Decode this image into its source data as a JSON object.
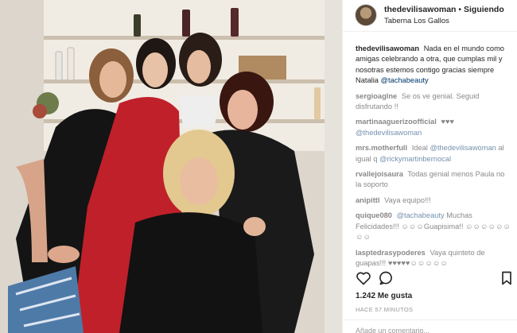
{
  "post": {
    "author": "thedevilisawoman",
    "separator": "•",
    "follow_label": "Siguiendo",
    "location": "Taberna Los Gallos",
    "caption_user": "thedevilisawoman",
    "caption_text": "Nada en el mundo como amigas celebrando a otra, que cumplas mil y nosotras estemos contigo gracias siempre Natalia",
    "caption_mention": "@tachabeauty"
  },
  "comments": [
    {
      "user": "sergioaglne",
      "text": "Se os ve genial. Seguid disfrutando !!"
    },
    {
      "user": "martinaaguerizoofficial",
      "text": "♥♥♥",
      "mention": "@thedevilisawoman"
    },
    {
      "user": "mrs.motherfull",
      "text": "Ideal",
      "mention": "@thedevilisawoman",
      "text2": "al igual q",
      "mention2": "@rickymartinbernocal"
    },
    {
      "user": "rvallejoisaura",
      "text": "Todas genial menos Paula no la soporto"
    },
    {
      "user": "anipittl",
      "text": "Vaya equipo!!!"
    },
    {
      "user": "quique080",
      "mention": "@tachabeauty",
      "text": "Muchas Felicidades!!! ☺☺☺Guapisima!! ☺☺☺☺☺☺☺☺"
    },
    {
      "user": "lasptedrasypoderes",
      "text": "Vaya quinteto de guapas!!! ♥♥♥♥♥☺☺☺☺☺"
    }
  ],
  "stats": {
    "likes": "1.242 Me gusta",
    "time": "HACE 57 MINUTOS",
    "add_comment_placeholder": "Añade un comentario..."
  },
  "icons": {
    "like": "heart-icon",
    "comment": "comment-icon",
    "save": "bookmark-icon",
    "avatar": "avatar"
  },
  "colors": {
    "mention": "#003569",
    "muted": "#999999",
    "text": "#262626"
  }
}
